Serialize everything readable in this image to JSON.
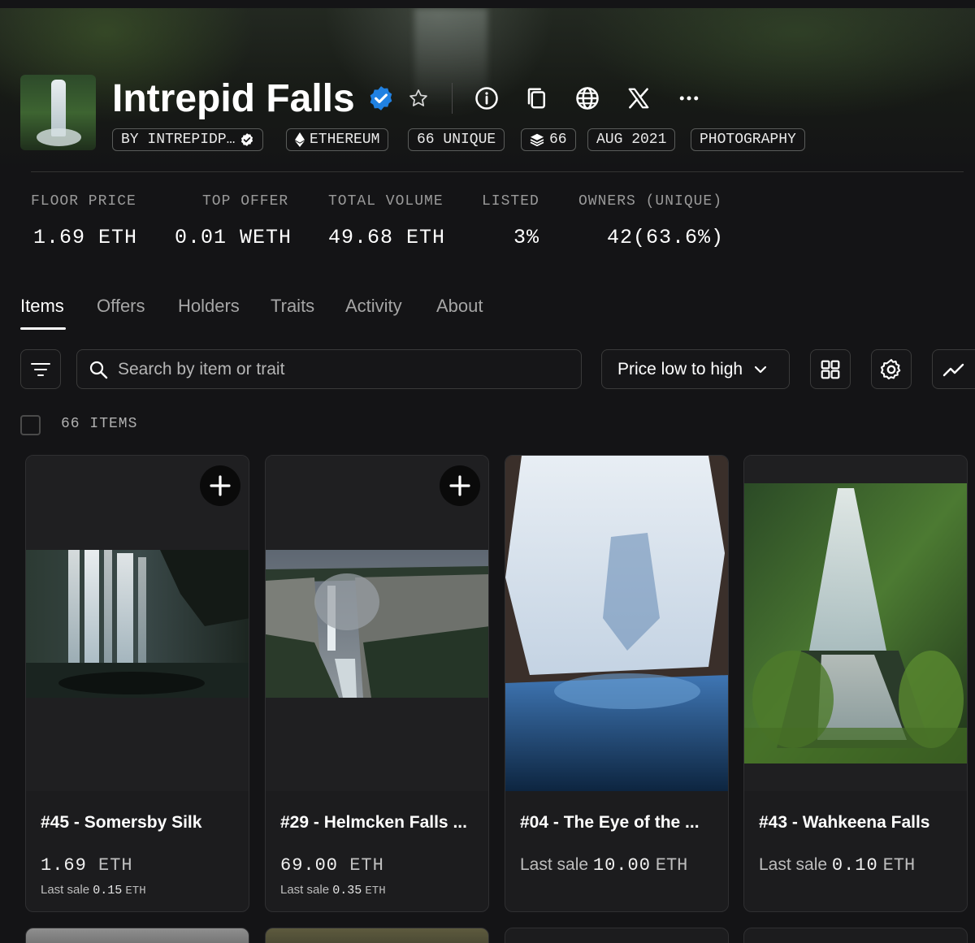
{
  "collection": {
    "title": "Intrepid Falls",
    "chips": {
      "creator": "BY INTREPIDP…",
      "chain": "ETHEREUM",
      "unique": "66 UNIQUE",
      "supply": "66",
      "date": "AUG 2021",
      "category": "PHOTOGRAPHY"
    },
    "header_icons": [
      "verified-badge-icon",
      "star-icon",
      "info-icon",
      "copy-icon",
      "globe-icon",
      "x-icon",
      "more-icon"
    ]
  },
  "stats": [
    {
      "label": "FLOOR PRICE",
      "value": "1.69 ETH"
    },
    {
      "label": "TOP OFFER",
      "value": "0.01 WETH"
    },
    {
      "label": "TOTAL VOLUME",
      "value": "49.68 ETH"
    },
    {
      "label": "LISTED",
      "value": "3%"
    },
    {
      "label": "OWNERS (UNIQUE)",
      "value": "42(63.6%)"
    }
  ],
  "tabs": [
    {
      "label": "Items",
      "active": true
    },
    {
      "label": "Offers"
    },
    {
      "label": "Holders"
    },
    {
      "label": "Traits"
    },
    {
      "label": "Activity"
    },
    {
      "label": "About"
    }
  ],
  "toolbar": {
    "search_placeholder": "Search by item or trait",
    "sort_selected": "Price low to high"
  },
  "items_count": "66 ITEMS",
  "cards": [
    {
      "name": "#45 - Somersby Silk",
      "price": "1.69",
      "price_unit": "ETH",
      "last_sale_label": "Last sale",
      "last_sale": "0.15",
      "last_sale_unit": "ETH"
    },
    {
      "name": "#29 - Helmcken Falls ...",
      "price": "69.00",
      "price_unit": "ETH",
      "last_sale_label": "Last sale",
      "last_sale": "0.35",
      "last_sale_unit": "ETH"
    },
    {
      "name": "#04 - The Eye of the ...",
      "last_sale_label": "Last sale",
      "last_sale": "10.00",
      "last_sale_unit": "ETH"
    },
    {
      "name": "#43 - Wahkeena Falls",
      "last_sale_label": "Last sale",
      "last_sale": "0.10",
      "last_sale_unit": "ETH"
    }
  ],
  "colors": {
    "background": "#141416",
    "card": "#1c1c1e",
    "verified": "#2081e2",
    "muted_text": "#9a9a9a"
  }
}
